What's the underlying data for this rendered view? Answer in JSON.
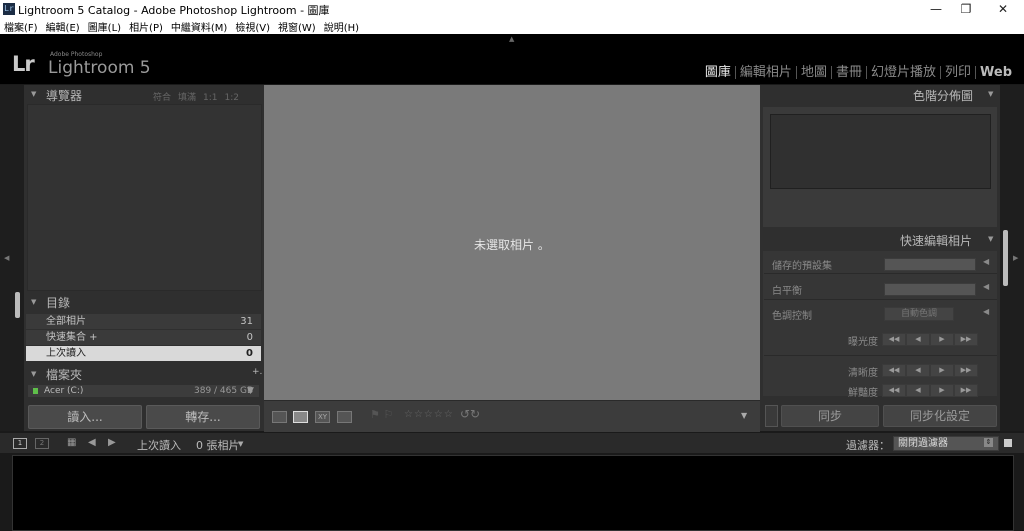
{
  "window": {
    "title": "Lightroom 5 Catalog - Adobe Photoshop Lightroom - 圖庫",
    "app_icon_text": "Lr",
    "controls": {
      "minimize": "—",
      "maximize": "❐",
      "close": "✕"
    }
  },
  "menu": [
    "檔案(F)",
    "編輯(E)",
    "圖庫(L)",
    "相片(P)",
    "中繼資料(M)",
    "檢視(V)",
    "視窗(W)",
    "說明(H)"
  ],
  "identity": {
    "logo": "Lr",
    "adobe": "Adobe Photoshop",
    "product": "Lightroom 5"
  },
  "modules": [
    "圖庫",
    "編輯相片",
    "地圖",
    "書冊",
    "幻燈片播放",
    "列印",
    "Web"
  ],
  "left_panel": {
    "navigator": {
      "title": "導覽器",
      "views": [
        "符合",
        "填滿",
        "1:1",
        "1:2"
      ]
    },
    "catalog": {
      "title": "目錄",
      "items": [
        {
          "label": "全部相片",
          "count": "31"
        },
        {
          "label": "快速集合 +",
          "count": "0"
        },
        {
          "label": "上次讀入",
          "count": "0"
        }
      ]
    },
    "folders": {
      "title": "檔案夾",
      "add": "+.",
      "volume": "Acer (C:)",
      "volume_info": "389 / 465 GB"
    },
    "import_button": "讀入...",
    "export_button": "轉存..."
  },
  "center": {
    "empty_message": "未選取相片 。"
  },
  "right_panel": {
    "histogram": {
      "title": "色階分佈圖"
    },
    "quick_develop": {
      "title": "快速編輯相片",
      "saved_preset": "儲存的預設集",
      "white_balance": "白平衡",
      "tone_control": "色調控制",
      "auto_tone": "自動色調",
      "exposure": "曝光度",
      "clarity": "清晰度",
      "vibrance": "鮮豔度"
    },
    "sync_button": "同步",
    "sync_settings_button": "同步化設定"
  },
  "filmstrip_bar": {
    "source": "上次讀入",
    "count": "0 張相片",
    "filter_label": "過濾器：",
    "filter_value": "關閉過濾器"
  },
  "toolbar": {
    "rating": "☆☆☆☆☆"
  }
}
